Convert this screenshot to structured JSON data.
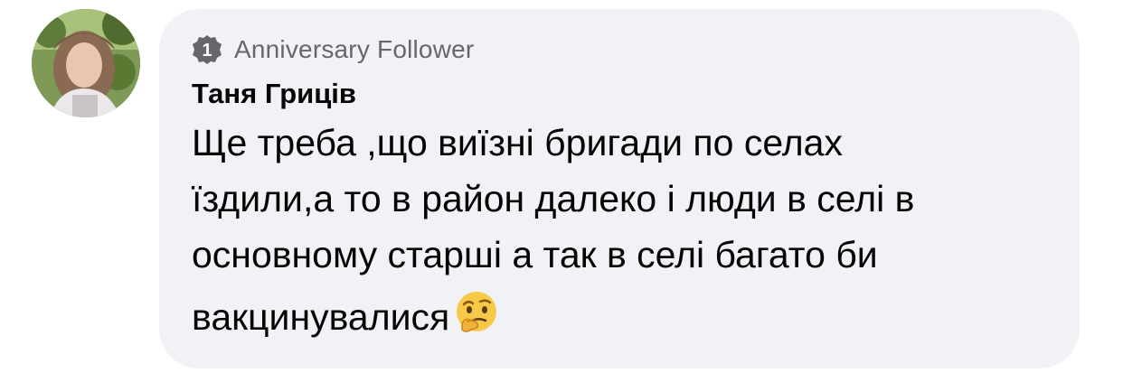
{
  "comment": {
    "badge": {
      "icon": "anniversary-badge-icon",
      "number": "1",
      "label": "Anniversary Follower"
    },
    "author": "Таня Гриців",
    "text_lines": [
      "Ще треба ,що виїзні бригади по селах",
      "їздили,а то в район далеко і люди в селі в",
      "основному старші а так в селі багато би",
      "вакцинувалися"
    ],
    "emoji": "thinking-face-emoji"
  },
  "colors": {
    "bubble_bg": "#f0f2f5",
    "badge_icon": "#65676b",
    "secondary_text": "#65676b",
    "primary_text": "#050505"
  }
}
